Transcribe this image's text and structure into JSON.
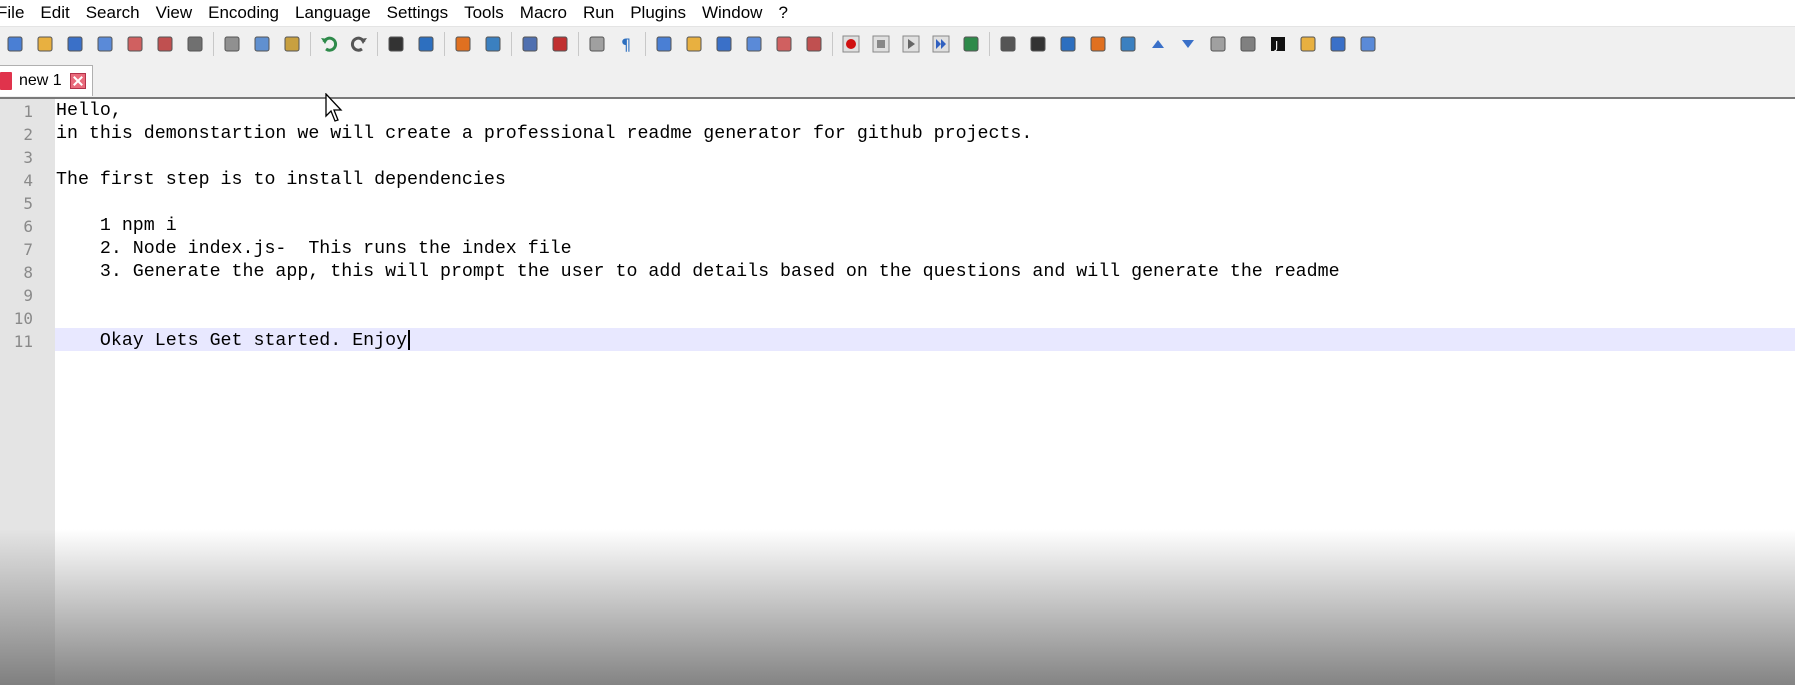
{
  "menu": [
    "File",
    "Edit",
    "Search",
    "View",
    "Encoding",
    "Language",
    "Settings",
    "Tools",
    "Macro",
    "Run",
    "Plugins",
    "Window",
    "?"
  ],
  "toolbar_groups": [
    [
      "new-file-icon",
      "open-file-icon",
      "save-icon",
      "save-all-icon",
      "close-icon",
      "close-all-icon",
      "print-icon"
    ],
    [
      "cut-icon",
      "copy-icon",
      "paste-icon"
    ],
    [
      "undo-icon",
      "redo-icon"
    ],
    [
      "find-icon",
      "replace-icon"
    ],
    [
      "zoom-in-icon",
      "zoom-out-icon"
    ],
    [
      "sync-vertical-icon",
      "sync-horizontal-icon"
    ],
    [
      "word-wrap-icon",
      "show-all-characters-icon"
    ],
    [
      "indent-guide-icon",
      "document-map-icon",
      "function-list-icon",
      "pdf-icon",
      "folder-workspace-icon",
      "monitoring-icon"
    ],
    [
      "record-macro-icon",
      "stop-recording-icon",
      "play-macro-icon",
      "run-macro-multiple-icon",
      "save-macro-icon"
    ],
    [
      "plugin-a-icon",
      "plugin-b-icon",
      "plugin-c-icon",
      "plugin-d-icon",
      "plugin-e-icon",
      "arrow-up-icon",
      "arrow-down-icon",
      "plugin-f-icon",
      "plugin-g-icon",
      "plugin-j-icon",
      "plugin-h-icon",
      "plugin-i-icon",
      "spellcheck-icon"
    ]
  ],
  "tab": {
    "label": "new 1"
  },
  "editor": {
    "lines": [
      "Hello,",
      "in this demonstartion we will create a professional readme generator for github projects.",
      "",
      "The first step is to install dependencies",
      "",
      "    1 npm i",
      "    2. Node index.js-  This runs the index file",
      "    3. Generate the app, this will prompt the user to add details based on the questions and will generate the readme",
      "",
      "",
      "    Okay Lets Get started. Enjoy"
    ],
    "line_numbers": [
      "1",
      "2",
      "3",
      "4",
      "5",
      "6",
      "7",
      "8",
      "9",
      "10",
      "11"
    ],
    "current_line": 11
  },
  "colors": {
    "gutter": "#e4e4e4",
    "current_line_highlight": "#e8e8ff",
    "line_number_text": "#8a8a8a"
  }
}
